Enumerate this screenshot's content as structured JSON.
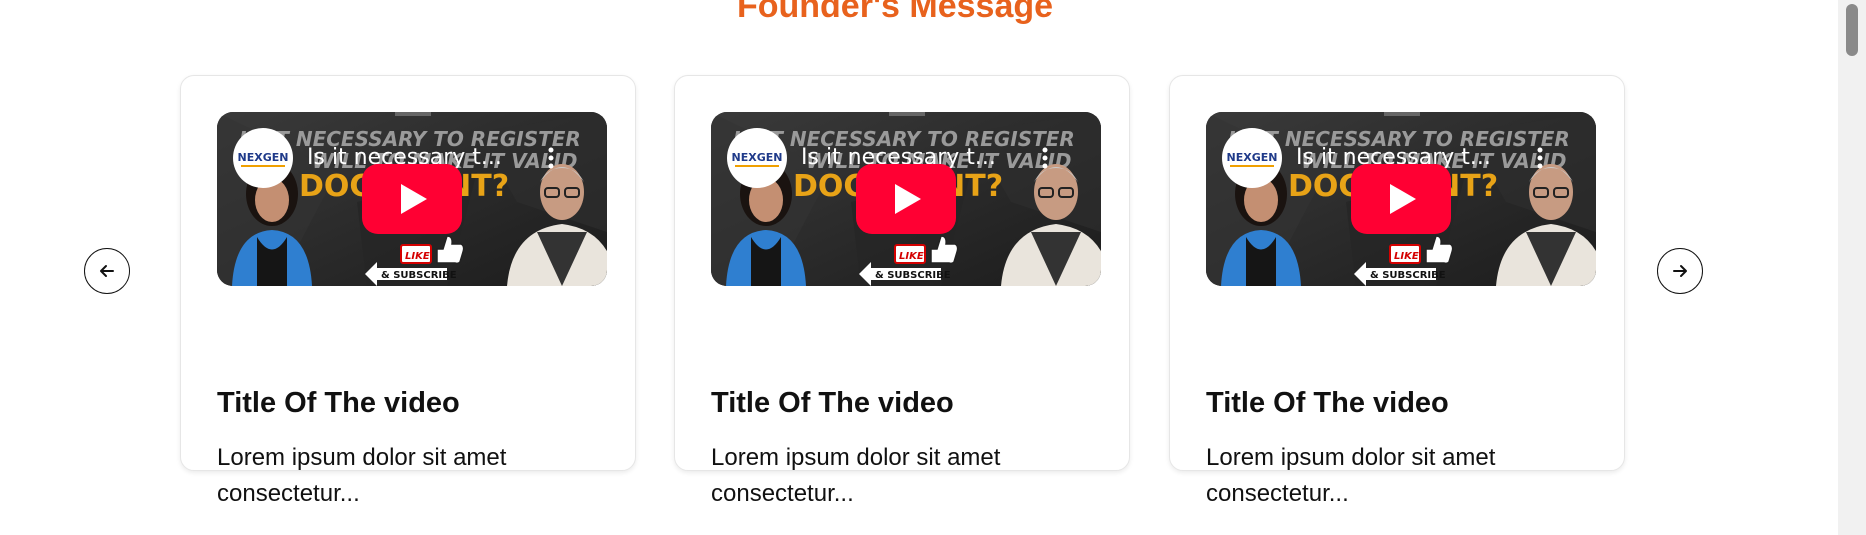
{
  "section": {
    "title": "Founder's Message"
  },
  "carousel": {
    "prev_icon": "arrow-left-icon",
    "next_icon": "arrow-right-icon",
    "cards": [
      {
        "thumbnail": {
          "channel_logo": "NEXGEN",
          "video_title": "Is it necessary t...",
          "headline_line1": "IS IT NECESSARY TO REGISTER",
          "headline_line2": "WILL TO MAKE IT VALID",
          "headline_line3": "DOCUMENT?",
          "like_label": "LIKE",
          "subscribe_label": "& SUBSCRIBE"
        },
        "title": "Title Of The video",
        "description": "Lorem ipsum dolor sit amet consectetur..."
      },
      {
        "thumbnail": {
          "channel_logo": "NEXGEN",
          "video_title": "Is it necessary t...",
          "headline_line1": "IS IT NECESSARY TO REGISTER",
          "headline_line2": "WILL TO MAKE IT VALID",
          "headline_line3": "DOCUMENT?",
          "like_label": "LIKE",
          "subscribe_label": "& SUBSCRIBE"
        },
        "title": "Title Of The video",
        "description": "Lorem ipsum dolor sit amet consectetur..."
      },
      {
        "thumbnail": {
          "channel_logo": "NEXGEN",
          "video_title": "Is it necessary t...",
          "headline_line1": "IS IT NECESSARY TO REGISTER",
          "headline_line2": "WILL TO MAKE IT VALID",
          "headline_line3": "DOCUMENT?",
          "like_label": "LIKE",
          "subscribe_label": "& SUBSCRIBE"
        },
        "title": "Title Of The video",
        "description": "Lorem ipsum dolor sit amet consectetur..."
      }
    ]
  },
  "colors": {
    "accent": "#e8621d",
    "play_button": "#ff0033",
    "headline_gold": "#e8a317"
  }
}
